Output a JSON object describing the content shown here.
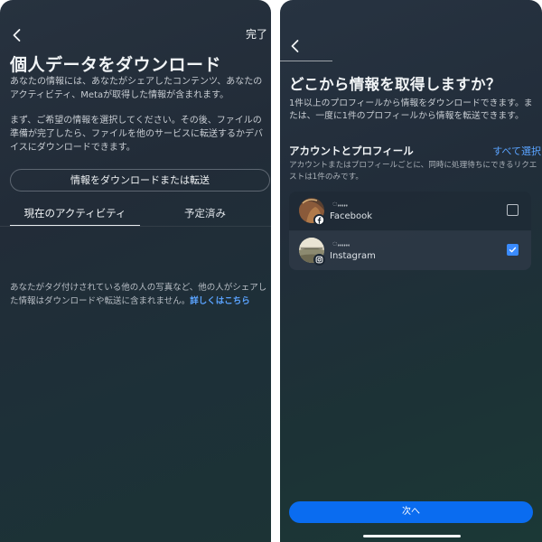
{
  "left": {
    "done_label": "完了",
    "title": "個人データをダウンロード",
    "paragraph1": "あなたの情報には、あなたがシェアしたコンテンツ、あなたのアクティビティ、Metaが取得した情報が含まれます。",
    "paragraph2": "まず、ご希望の情報を選択してください。その後、ファイルの準備が完了したら、ファイルを他のサービスに転送するかデバイスにダウンロードできます。",
    "download_button": "情報をダウンロードまたは転送",
    "tabs": [
      {
        "label": "現在のアクティビティ",
        "active": true
      },
      {
        "label": "予定済み",
        "active": false
      }
    ],
    "footer_text": "あなたがタグ付けされている他の人の写真など、他の人がシェアした情報はダウンロードや転送に含まれません。",
    "footer_link": "詳しくはこちら"
  },
  "right": {
    "title": "どこから情報を取得しますか？",
    "paragraph": "1件以上のプロフィールから情報をダウンロードできます。または、一度に1件のプロフィールから情報を転送できます。",
    "section_title": "アカウントとプロフィール",
    "select_all": "すべて選択",
    "note": "アカウントまたはプロフィールごとに、同時に処理待ちにできるリクエストは1件のみです。",
    "accounts": [
      {
        "name": "ꩻꩻꩻꩻꩻ",
        "platform": "Facebook",
        "icon": "facebook-icon",
        "checked": false
      },
      {
        "name": "ꩻꩻꩻꩻꩻꩻ",
        "platform": "Instagram",
        "icon": "instagram-icon",
        "checked": true
      }
    ],
    "next_button": "次へ"
  },
  "colors": {
    "accent": "#0a6cf0",
    "link": "#5aa3ff",
    "checkbox_checked": "#3a8bff"
  }
}
